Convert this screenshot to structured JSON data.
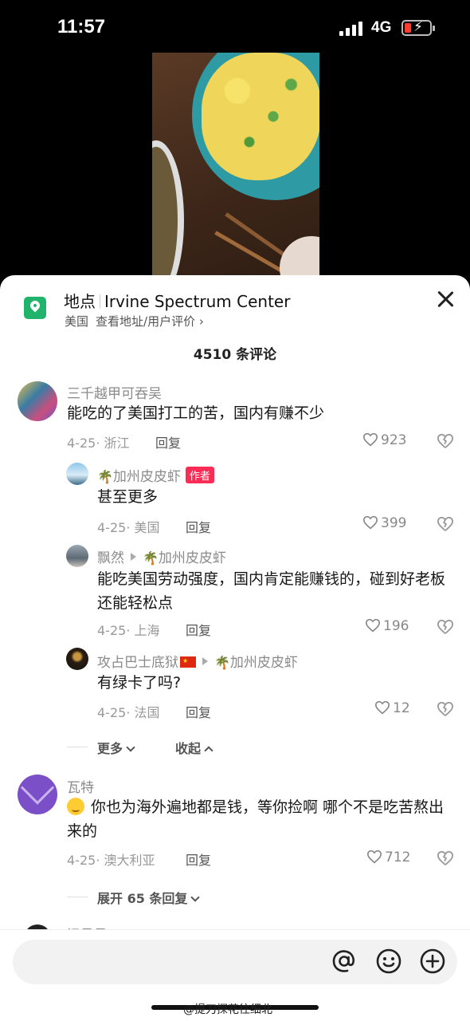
{
  "status_bar": {
    "time": "11:57",
    "network": "4G"
  },
  "location": {
    "label": "地点",
    "name": "Irvine Spectrum Center",
    "country": "美国",
    "detail_link": "查看地址/用户评价 ›"
  },
  "comments_count": "4510 条评论",
  "comments": [
    {
      "user": "三千越甲可吞吴",
      "text": "能吃的了美国打工的苦，国内有赚不少",
      "meta": "4-25· 浙江",
      "reply": "回复",
      "likes": "923",
      "replies": [
        {
          "user": "加州皮皮虾",
          "badge": "作者",
          "text": "甚至更多",
          "meta": "4-25· 美国",
          "reply": "回复",
          "likes": "399"
        },
        {
          "user": "飘然",
          "reply_to": "加州皮皮虾",
          "text": "能吃美国劳动强度，国内肯定能赚钱的，碰到好老板还能轻松点",
          "meta": "4-25· 上海",
          "reply": "回复",
          "likes": "196"
        },
        {
          "user": "攻占巴士底狱",
          "reply_to": "加州皮皮虾",
          "text": "有绿卡了吗?",
          "meta": "4-25· 法国",
          "reply": "回复",
          "likes": "12"
        }
      ],
      "more_label": "更多",
      "collapse_label": "收起"
    },
    {
      "user": "瓦特",
      "text": "你也为海外遍地都是钱，等你捡啊 哪个不是吃苦熬出来的",
      "meta": "4-25· 澳大利亚",
      "reply": "回复",
      "likes": "712",
      "expand_label": "展开 65 条回复"
    }
  ],
  "partial_next_user": "温柔柔",
  "input": {
    "placeholder": ""
  },
  "watermark": "@提刀探花往细北",
  "colors": {
    "accent": "#fe2c55",
    "location_green": "#1fb36b",
    "battery_low": "#ff3b30"
  },
  "icons": [
    "location-pin-icon",
    "close-icon",
    "heart-icon",
    "dislike-icon",
    "at-icon",
    "emoji-icon",
    "plus-icon"
  ]
}
